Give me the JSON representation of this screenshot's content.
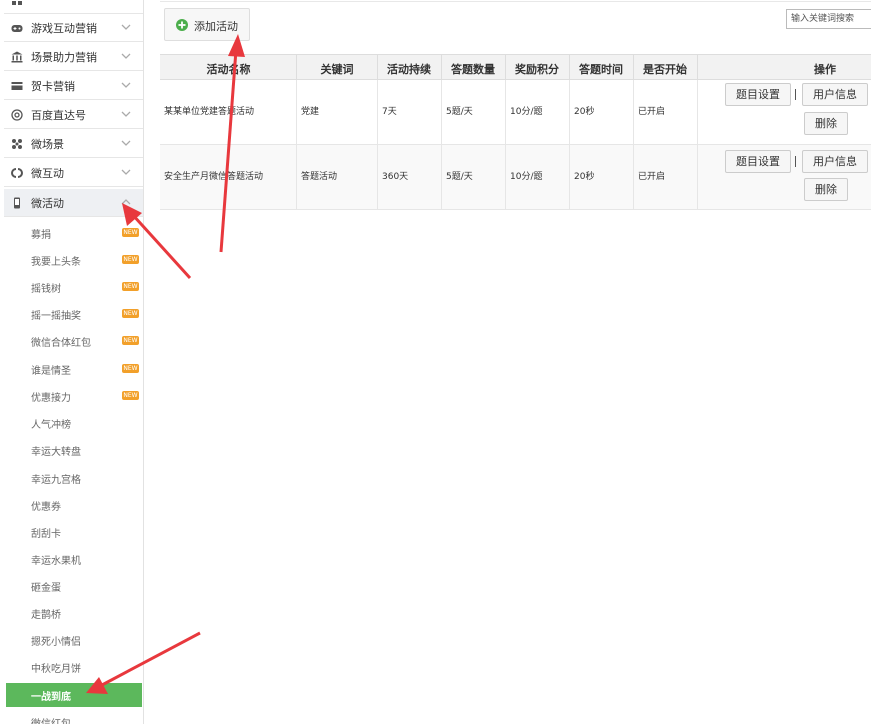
{
  "sidebar": {
    "groups": [
      {
        "label": "",
        "icon": "grid-icon"
      },
      {
        "label": "游戏互动营销",
        "icon": "gamepad-icon"
      },
      {
        "label": "场景助力营销",
        "icon": "bank-icon"
      },
      {
        "label": "贺卡营销",
        "icon": "card-icon"
      },
      {
        "label": "百度直达号",
        "icon": "at-icon"
      },
      {
        "label": "微场景",
        "icon": "scene-icon"
      },
      {
        "label": "微互动",
        "icon": "interact-icon"
      },
      {
        "label": "微活动",
        "icon": "phone-icon"
      }
    ],
    "sub_items": [
      {
        "label": "募捐",
        "new": "NEW"
      },
      {
        "label": "我要上头条",
        "new": "NEW"
      },
      {
        "label": "摇钱树",
        "new": "NEW"
      },
      {
        "label": "摇一摇抽奖",
        "new": "NEW"
      },
      {
        "label": "微信合体红包",
        "new": "NEW"
      },
      {
        "label": "谁是情圣",
        "new": "NEW"
      },
      {
        "label": "优惠接力",
        "new": "NEW"
      },
      {
        "label": "人气冲榜"
      },
      {
        "label": "幸运大转盘"
      },
      {
        "label": "幸运九宫格"
      },
      {
        "label": "优惠券"
      },
      {
        "label": "刮刮卡"
      },
      {
        "label": "幸运水果机"
      },
      {
        "label": "砸金蛋"
      },
      {
        "label": "走鹊桥"
      },
      {
        "label": "摁死小情侣"
      },
      {
        "label": "中秋吃月饼"
      },
      {
        "label": "一战到底"
      },
      {
        "label": "微信红包"
      }
    ]
  },
  "toolbar": {
    "add_label": "添加活动",
    "search_placeholder": "输入关键词搜索"
  },
  "table": {
    "headers": [
      "活动名称",
      "关键词",
      "活动持续",
      "答题数量",
      "奖励积分",
      "答题时间",
      "是否开始",
      "操作"
    ],
    "rows": [
      {
        "name": "某某单位党建答题活动",
        "keyword": "党建",
        "duration": "7天",
        "count": "5题/天",
        "points": "10分/题",
        "time": "20秒",
        "status": "已开启"
      },
      {
        "name": "安全生产月微信答题活动",
        "keyword": "答题活动",
        "duration": "360天",
        "count": "5题/天",
        "points": "10分/题",
        "time": "20秒",
        "status": "已开启"
      }
    ],
    "actions": {
      "settings": "题目设置",
      "users": "用户信息",
      "delete": "删除"
    }
  },
  "colors": {
    "active_green": "#5cb85c",
    "new_badge": "#f2a02a",
    "arrow_red": "#e8383d"
  }
}
